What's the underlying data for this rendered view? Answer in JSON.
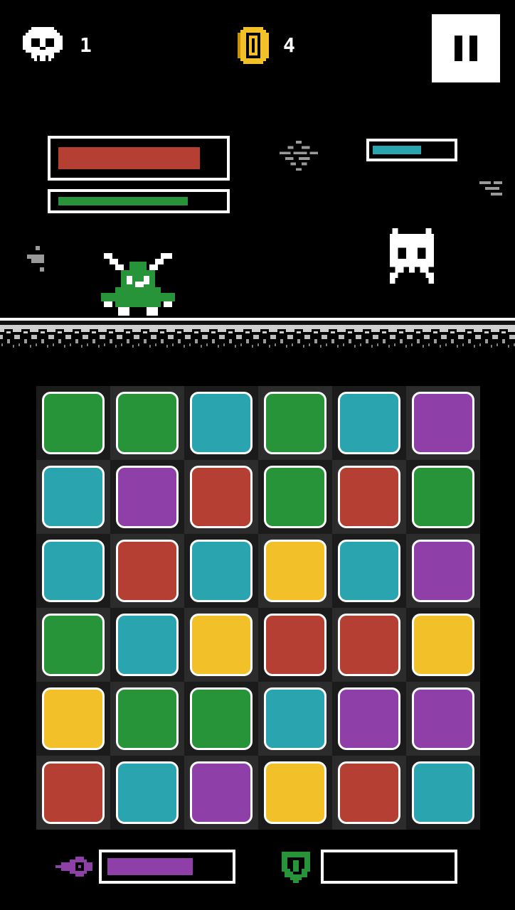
{
  "hud": {
    "skulls": "1",
    "coins": "4"
  },
  "colors": {
    "green": "#27943a",
    "teal": "#2aa4ae",
    "purple": "#8e3fa8",
    "red": "#b43f32",
    "yellow": "#f2c12a",
    "tile_dark": "#1b1b1b",
    "tile_light": "#2c2c2c"
  },
  "player": {
    "health_level": 0.83,
    "health_color": "#b43f32",
    "stamina_level": 0.77,
    "stamina_color": "#27943a"
  },
  "enemy": {
    "health_level": 0.58,
    "health_color": "#2aa4ae"
  },
  "abilities": {
    "magic_icon": "purple-fireball-icon",
    "magic_level": 0.68,
    "magic_color": "#8e3fa8",
    "shield_icon": "green-shield-icon",
    "shield_level": 0,
    "shield_color": "#27943a"
  },
  "board": {
    "rows": [
      [
        "green",
        "green",
        "teal",
        "green",
        "teal",
        "purple"
      ],
      [
        "teal",
        "purple",
        "red",
        "green",
        "red",
        "green"
      ],
      [
        "teal",
        "red",
        "teal",
        "yellow",
        "teal",
        "purple"
      ],
      [
        "green",
        "teal",
        "yellow",
        "red",
        "red",
        "yellow"
      ],
      [
        "yellow",
        "green",
        "green",
        "teal",
        "purple",
        "purple"
      ],
      [
        "red",
        "teal",
        "purple",
        "yellow",
        "red",
        "teal"
      ]
    ]
  }
}
